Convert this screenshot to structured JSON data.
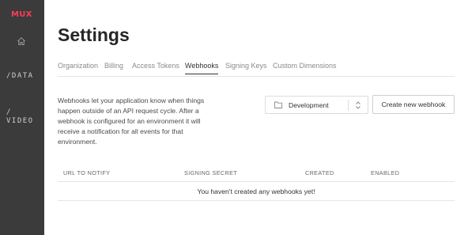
{
  "brand": {
    "logo_text": "MUX",
    "logo_color": "#fa3d55"
  },
  "sidebar": {
    "home_icon": "home-icon",
    "items": [
      {
        "label": "/DATA"
      },
      {
        "slash": "/",
        "label": "VIDEO"
      }
    ]
  },
  "page": {
    "title": "Settings"
  },
  "tabs": [
    {
      "label": "Organization",
      "active": false
    },
    {
      "label": "Billing",
      "active": false
    },
    {
      "label": "Access Tokens",
      "active": false
    },
    {
      "label": "Webhooks",
      "active": true
    },
    {
      "label": "Signing Keys",
      "active": false
    },
    {
      "label": "Custom Dimensions",
      "active": false
    }
  ],
  "webhooks": {
    "description": "Webhooks let your application know when things happen outside of an API request cycle. After a webhook is configured for an environment it will receive a notification for all events for that environment.",
    "environment_select": {
      "value": "Development",
      "icon": "folder-icon"
    },
    "create_button_label": "Create new webhook",
    "table": {
      "headers": [
        "URL TO NOTIFY",
        "SIGNING SECRET",
        "CREATED",
        "ENABLED"
      ],
      "empty_message": "You haven't created any webhooks yet!"
    }
  }
}
